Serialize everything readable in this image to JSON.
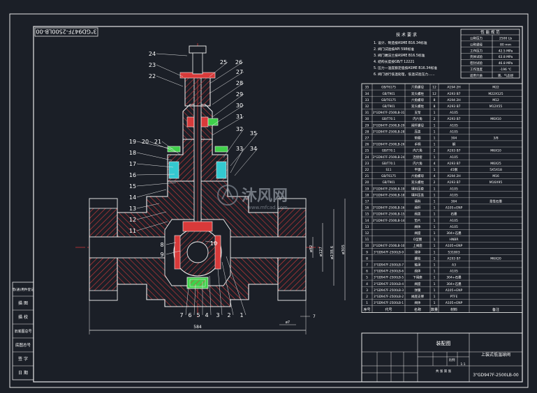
{
  "drawing_number_rotated": "3\"GD947F-2500LB-00",
  "tech_requirements": {
    "title": "技 术 要 求",
    "lines": [
      "1. 设计、制造按ASME B16.34标准",
      "2. 阀门试验按API 598标准",
      "3. 阀门端法兰按ASME B16.5标准",
      "4. 结构长度按GB/T 12221",
      "5. 压力—温度额定值按ASME B16.34标准",
      "6. 阀门进行低温处理，低温试验压力……"
    ]
  },
  "spec_table": {
    "title": "性 能 规 范",
    "rows": [
      [
        "公称压力",
        "2500 Lb"
      ],
      [
        "公称通径",
        "80 mm"
      ],
      [
        "工作压力",
        "42.5 MPa"
      ],
      [
        "壳体试验",
        "63.8 MPa"
      ],
      [
        "密封试验",
        "46.8 MPa"
      ],
      [
        "工作温度",
        "-196 ℃"
      ],
      [
        "适用介质",
        "液、气态烃"
      ]
    ]
  },
  "part_labels": [
    "24",
    "23",
    "22",
    "25",
    "26",
    "27",
    "28",
    "29",
    "30",
    "31",
    "32",
    "35",
    "33",
    "34",
    "19",
    "20",
    "21",
    "18",
    "17",
    "16",
    "15",
    "14",
    "13",
    "12",
    "11",
    "8",
    "9",
    "10",
    "7",
    "6",
    "5",
    "4",
    "3",
    "2",
    "1"
  ],
  "dimensions": {
    "overall_length": "584",
    "d1": "ø82",
    "d2": "ø127",
    "d3": "ø238.6",
    "d4": "ø305",
    "pitch": "ø7",
    "small": "7"
  },
  "bom": {
    "rows": [
      [
        "35",
        "GB/T6175",
        "六角螺母",
        "12",
        "A194 2H",
        "M22"
      ],
      [
        "34",
        "GB/T901",
        "双头螺柱",
        "12",
        "A193 B7",
        "M22X125"
      ],
      [
        "33",
        "GB/T6175",
        "六角螺母",
        "8",
        "A194 2H",
        "M12"
      ],
      [
        "32",
        "GB/T901",
        "双头螺柱",
        "8",
        "A193 B7",
        "M12X55"
      ],
      [
        "31",
        "3\"GD947F-2500LB-31",
        "支架",
        "1",
        "A105",
        ""
      ],
      [
        "30",
        "GB/T70.1",
        "内六角",
        "2",
        "A193 B7",
        "M6X10"
      ],
      [
        "29",
        "3\"GD947F-2500LB-29",
        "阀杆螺母",
        "1",
        "A105",
        ""
      ],
      [
        "28",
        "3\"GD947F-2500LB-28",
        "压盖",
        "1",
        "A105",
        ""
      ],
      [
        "27",
        "",
        "垫圈",
        "1",
        "304",
        "3/8"
      ],
      [
        "26",
        "3\"GD947F-2500LB-26",
        "手柄",
        "1",
        "钢",
        ""
      ],
      [
        "25",
        "GB/T70.1",
        "内六角",
        "2",
        "A193 B7",
        "M6X10"
      ],
      [
        "24",
        "3\"GD947F-2500LB-24",
        "连接套",
        "1",
        "A105",
        ""
      ],
      [
        "23",
        "GB/T70.1",
        "内六角",
        "4",
        "A193 B7",
        "M6X25"
      ],
      [
        "22",
        "S11",
        "平键",
        "1",
        "45钢",
        "5X5X18"
      ],
      [
        "21",
        "GB/T6175",
        "六角螺母",
        "4",
        "A194 2H",
        "M16"
      ],
      [
        "20",
        "GB/T901",
        "双头螺柱",
        "2",
        "A193 B7",
        "M16X95"
      ],
      [
        "19",
        "3\"GD947F-2500LB-19",
        "填料压套",
        "1",
        "A105",
        ""
      ],
      [
        "18",
        "3\"GD947F-2500LB-18",
        "填料压盖",
        "1",
        "A105",
        ""
      ],
      [
        "17",
        "",
        "填料",
        "1",
        "304",
        "柔性石墨"
      ],
      [
        "16",
        "3\"GD947F-2500LB-16",
        "阀杆",
        "1",
        "A105+ENP",
        ""
      ],
      [
        "15",
        "3\"GD947F-2500LB-15",
        "阀盖",
        "1",
        "石墨",
        ""
      ],
      [
        "14",
        "3\"GD947F-2500LB-14",
        "垫片",
        "1",
        "A105",
        ""
      ],
      [
        "13",
        "",
        "阀体",
        "1",
        "A105",
        ""
      ],
      [
        "12",
        "",
        "阀座",
        "1",
        "304+石墨",
        ""
      ],
      [
        "11",
        "",
        "O型圈",
        "1",
        "HNBR",
        ""
      ],
      [
        "10",
        "3\"GD947F-2500LB-10",
        "上阀座",
        "1",
        "A105+ENP",
        ""
      ],
      [
        "9",
        "3\"GD947F-2500LB-9",
        "球体",
        "1",
        "S31803",
        ""
      ],
      [
        "8",
        "",
        "螺栓",
        "1",
        "A193 B7",
        "M6X20"
      ],
      [
        "7",
        "3\"GD947F-2500LB-7",
        "轴承",
        "1",
        "A3",
        ""
      ],
      [
        "6",
        "3\"GD947F-2500LB-6",
        "阀体",
        "1",
        "A105",
        ""
      ],
      [
        "5",
        "3\"GD947F-2500LB-5",
        "下阀座",
        "1",
        "304+石墨",
        ""
      ],
      [
        "4",
        "3\"GD947F-2500LB-4",
        "阀座",
        "1",
        "304+石墨",
        ""
      ],
      [
        "3",
        "3\"GD947F-2500LB-3",
        "弹簧",
        "1",
        "A105+ENP",
        ""
      ],
      [
        "2",
        "3\"GD947F-2500LB-2",
        "阀座支撑",
        "1",
        "PTFE",
        ""
      ],
      [
        "1",
        "3\"GD947F-2500LB-1",
        "阀体",
        "1",
        "A105+ENP",
        ""
      ]
    ],
    "header": [
      "序号",
      "代号",
      "名称",
      "数量",
      "材料",
      "备注"
    ]
  },
  "title_block": {
    "drawing_name": "装配图",
    "product_name": "上装式低温球阀",
    "drawing_code": "3\"GD947F-2500LB-00",
    "scale_label": "比例",
    "scale": "1:1",
    "sheet": "共 张 第 张"
  },
  "left_stamp_labels": [
    "借(通)用件登记",
    "描 图",
    "描 校",
    "旧底图总号",
    "底图总号",
    "签 字",
    "日 期"
  ],
  "watermark": {
    "brand": "沐风网",
    "url": "www.mfcad.com"
  },
  "colors": {
    "background": "#1b1f27",
    "frame": "#e6e6e6",
    "outline": "#f2f2f2",
    "hatch": "#d83a3a",
    "center": "#d63a3a",
    "fill_cyan": "#34c9d0",
    "fill_green": "#3fd04a",
    "label_text": "#ffffff",
    "dim_line": "#e7e7e7"
  }
}
